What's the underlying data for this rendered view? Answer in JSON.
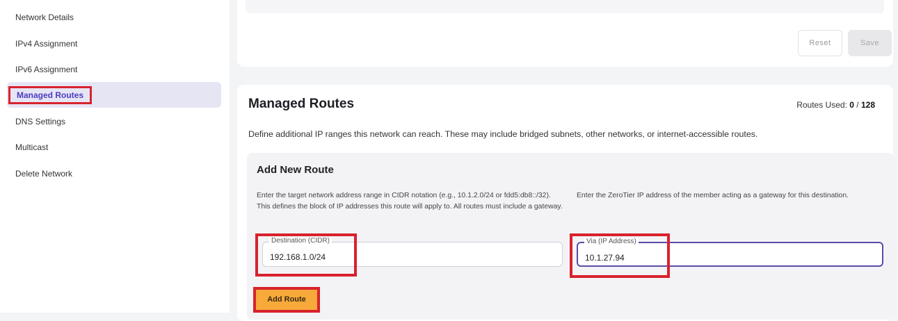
{
  "sidebar": {
    "items": [
      {
        "label": "Network Details"
      },
      {
        "label": "IPv4 Assignment"
      },
      {
        "label": "IPv6 Assignment"
      },
      {
        "label": "Managed Routes"
      },
      {
        "label": "DNS Settings"
      },
      {
        "label": "Multicast"
      },
      {
        "label": "Delete Network"
      }
    ],
    "active_index": 3
  },
  "top_actions": {
    "reset_label": "Reset",
    "save_label": "Save"
  },
  "managed_routes": {
    "title": "Managed Routes",
    "routes_used_label": "Routes Used:",
    "routes_used_count": "0",
    "routes_used_sep": "/",
    "routes_used_max": "128",
    "description": "Define additional IP ranges this network can reach. These may include bridged subnets, other networks, or internet-accessible routes."
  },
  "add_route": {
    "title": "Add New Route",
    "destination_help": "Enter the target network address range in CIDR notation (e.g., 10.1.2.0/24 or fdd5:db8::/32). This defines the block of IP addresses this route will apply to. All routes must include a gateway.",
    "via_help": "Enter the ZeroTier IP address of the member acting as a gateway for this destination.",
    "destination_label": "Destination (CIDR)",
    "destination_value": "192.168.1.0/24",
    "via_label": "Via (IP Address)",
    "via_value": "10.1.27.94",
    "button_label": "Add Route"
  },
  "colors": {
    "accent": "#4c3cbf",
    "highlight": "#d8222d",
    "button_orange": "#f7a93a"
  }
}
